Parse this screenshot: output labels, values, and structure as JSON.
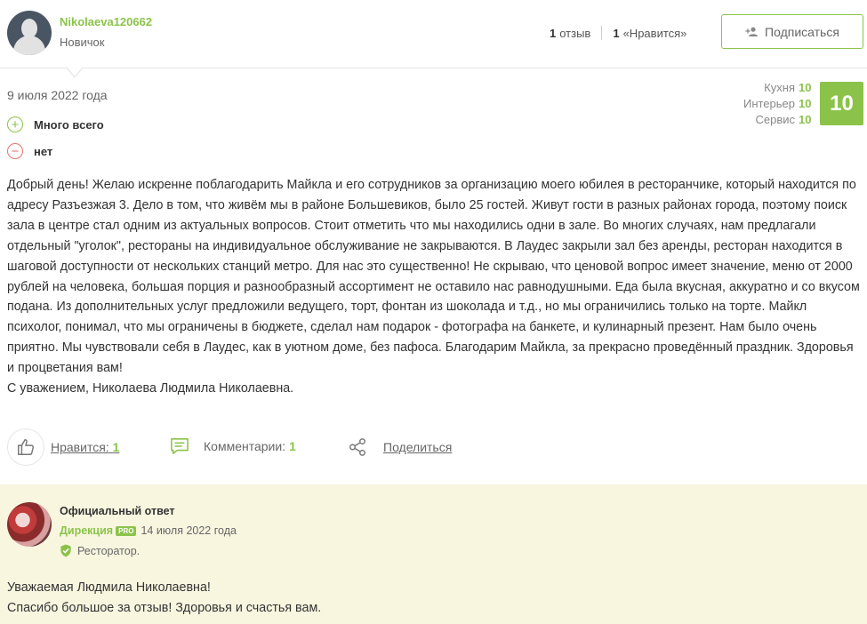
{
  "user": {
    "name": "Nikolaeva120662",
    "rank": "Новичок",
    "reviews_count": "1",
    "reviews_label": "отзыв",
    "likes_count": "1",
    "likes_label": "«Нравится»",
    "subscribe_label": "Подписаться"
  },
  "review": {
    "date": "9 июля 2022 года",
    "plus": "Много всего",
    "minus": "нет",
    "ratings": [
      {
        "label": "Кухня",
        "value": "10"
      },
      {
        "label": "Интерьер",
        "value": "10"
      },
      {
        "label": "Сервис",
        "value": "10"
      }
    ],
    "score": "10",
    "text": "Добрый день! Желаю искренне поблагодарить Майкла и его сотрудников за организацию моего юбилея в ресторанчике, который находится по адресу Разъезжая 3. Дело в том, что живём мы в районе Большевиков, было 25 гостей. Живут гости в разных районах города, поэтому поиск зала в центре стал одним из актуальных вопросов. Стоит отметить что мы находились одни в зале. Во многих случаях, нам предлагали отдельный \"уголок\", рестораны на индивидуальное обслуживание не закрываются. В Лаудес закрыли зал без аренды, ресторан находится в шаговой доступности от нескольких станций метро. Для нас это существенно! Не скрываю, что ценовой вопрос имеет значение, меню от 2000 рублей на человека, большая порция и разнообразный ассортимент не оставило нас равнодушными. Еда была вкусная, аккуратно и со вкусом подана. Из дополнительных услуг предложили ведущего, торт, фонтан из шоколада и т.д., но мы ограничились только на торте. Майкл психолог, понимал, что мы ограничены в бюджете, сделал нам подарок - фотографа на банкете, и кулинарный презент. Нам было очень приятно. Мы чувствовали себя в Лаудес, как в уютном доме, без пафоса. Благодарим Майкла, за прекрасно проведённый праздник. Здоровья и процветания вам!",
    "signature": "С уважением, Николаева Людмила Николаевна."
  },
  "actions": {
    "like_label": "Нравится:",
    "like_count": "1",
    "comments_label": "Комментарии:",
    "comments_count": "1",
    "share_label": "Поделиться"
  },
  "reply": {
    "title": "Официальный ответ",
    "author": "Дирекция",
    "badge": "PRO",
    "date": "14 июля 2022 года",
    "role": "Ресторатор.",
    "line1": "Уважаемая Людмила Николаевна!",
    "line2": "Спасибо большое за отзыв! Здоровья и счастья вам."
  },
  "colors": {
    "accent": "#8bc34a",
    "negative": "#e57373",
    "reply_bg": "#f9f6e0"
  }
}
